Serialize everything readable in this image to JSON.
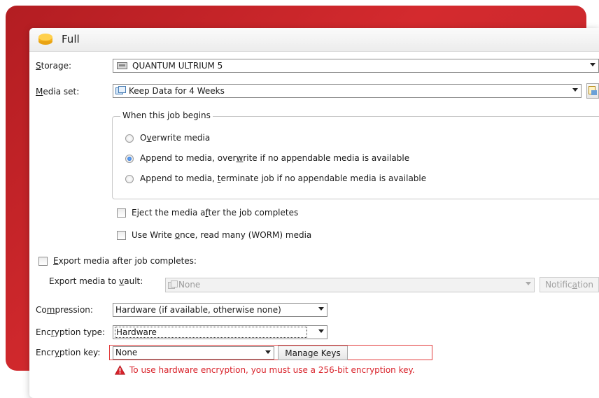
{
  "window": {
    "title": "Full"
  },
  "storage": {
    "label_pre": "",
    "label_u": "S",
    "label_post": "torage:",
    "value": "QUANTUM ULTRIUM 5"
  },
  "media_set": {
    "label_pre": "",
    "label_u": "M",
    "label_post": "edia set:",
    "value": "Keep Data for 4 Weeks"
  },
  "job_begins": {
    "legend": "When this job begins",
    "options": [
      {
        "pre": "O",
        "u": "v",
        "post": "erwrite media",
        "selected": false
      },
      {
        "pre": "Append to media, over",
        "u": "w",
        "post": "rite if no appendable media is available",
        "selected": true
      },
      {
        "pre": "Append to media, ",
        "u": "t",
        "post": "erminate job if no appendable media is available",
        "selected": false
      }
    ]
  },
  "eject": {
    "pre": "Eject the media a",
    "u": "f",
    "post": "ter the job completes",
    "checked": false
  },
  "worm": {
    "pre": "Use Write ",
    "u": "o",
    "post": "nce, read many (WORM) media",
    "checked": false
  },
  "export": {
    "pre": "",
    "u": "E",
    "post": "xport media after job completes:",
    "checked": false
  },
  "export_vault": {
    "pre": "Export media to ",
    "u": "v",
    "post": "ault:",
    "value": "None",
    "button_pre": "Notific",
    "button_u": "a",
    "button_post": "tion"
  },
  "compression": {
    "pre": "Co",
    "u": "m",
    "post": "pression:",
    "value": "Hardware (if available, otherwise none)"
  },
  "encryption_type": {
    "pre": "Enc",
    "u": "r",
    "post": "yption type:",
    "value": "Hardware"
  },
  "encryption_key": {
    "pre": "Encr",
    "u": "y",
    "post": "ption key:",
    "value": "None",
    "button_pre": "Mana",
    "button_u": "g",
    "button_post": "e Keys"
  },
  "error": {
    "message": "To use hardware encryption, you must use a 256-bit encryption key."
  },
  "colors": {
    "accent_red": "#c4262b",
    "error_text": "#d9232b",
    "radio_blue": "#1c5fc9"
  }
}
